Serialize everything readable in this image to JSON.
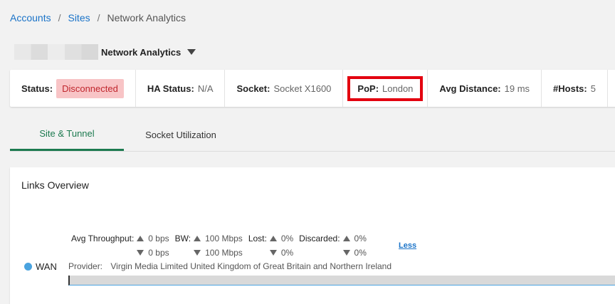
{
  "breadcrumb": {
    "items": [
      "Accounts",
      "Sites"
    ],
    "separator": "/",
    "current": "Network Analytics"
  },
  "title": {
    "text": "Network Analytics"
  },
  "status": {
    "status_label": "Status:",
    "status_value": "Disconnected",
    "ha_label": "HA Status:",
    "ha_value": "N/A",
    "socket_label": "Socket:",
    "socket_value": "Socket X1600",
    "pop_label": "PoP:",
    "pop_value": "London",
    "distance_label": "Avg Distance:",
    "distance_value": "19 ms",
    "hosts_label": "#Hosts:",
    "hosts_value": "5"
  },
  "tabs": [
    {
      "label": "Site & Tunnel",
      "active": true
    },
    {
      "label": "Socket Utilization",
      "active": false
    }
  ],
  "links_overview": {
    "title": "Links Overview",
    "link_name": "WAN",
    "throughput_label": "Avg Throughput:",
    "throughput_up": "0 bps",
    "throughput_down": "0 bps",
    "bw_label": "BW:",
    "bw_up": "100 Mbps",
    "bw_down": "100 Mbps",
    "lost_label": "Lost:",
    "lost_up": "0%",
    "lost_down": "0%",
    "discarded_label": "Discarded:",
    "discarded_up": "0%",
    "discarded_down": "0%",
    "less_label": "Less",
    "provider_label": "Provider:",
    "provider_value": "Virgin Media Limited United Kingdom of Great Britain and Northern Ireland"
  },
  "colors": {
    "link": "#1a73c8",
    "active_tab": "#1c7a4f",
    "disconnected_bg": "#f8c4c6",
    "disconnected_text": "#c0262d",
    "highlight": "#e3000f",
    "wan_dot": "#4aa3df"
  }
}
